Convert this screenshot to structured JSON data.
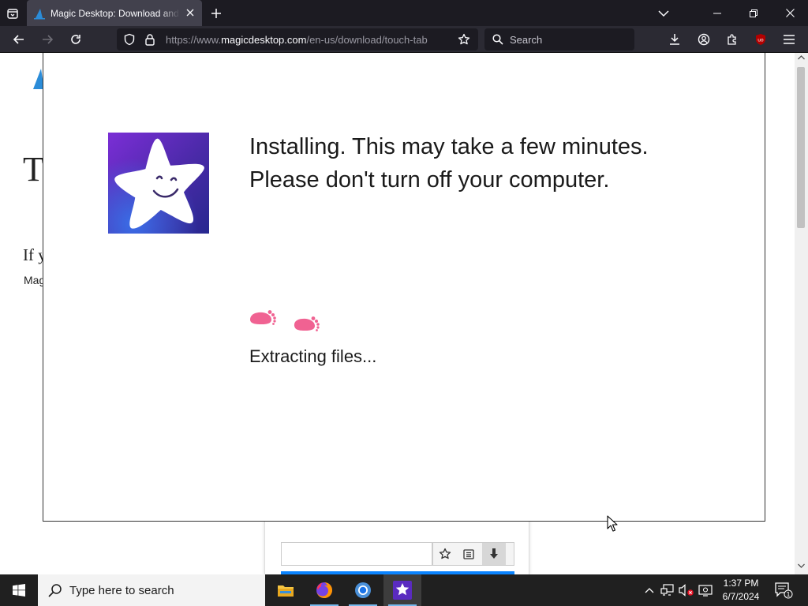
{
  "browser": {
    "tab": {
      "title": "Magic Desktop: Download and Ins"
    },
    "url": {
      "scheme": "https://www.",
      "host": "magicdesktop.com",
      "path": "/en-us/download/touch-tab"
    },
    "search": {
      "placeholder": "Search"
    }
  },
  "background_page": {
    "heading_fragment": "T",
    "paragraph_fragment": "If y",
    "small_fragment": "Mag"
  },
  "installer": {
    "message_line1": "Installing. This may take a few minutes.",
    "message_line2": "Please don't turn off your computer.",
    "status": "Extracting files...",
    "colors": {
      "footprint": "#f06292",
      "icon_bg": "#5a2bc0"
    }
  },
  "taskbar": {
    "search_placeholder": "Type here to search",
    "apps": [
      "file-explorer",
      "firefox",
      "chrome",
      "magic-desktop"
    ],
    "clock": {
      "time": "1:37 PM",
      "date": "6/7/2024"
    },
    "notification_count": "1"
  }
}
